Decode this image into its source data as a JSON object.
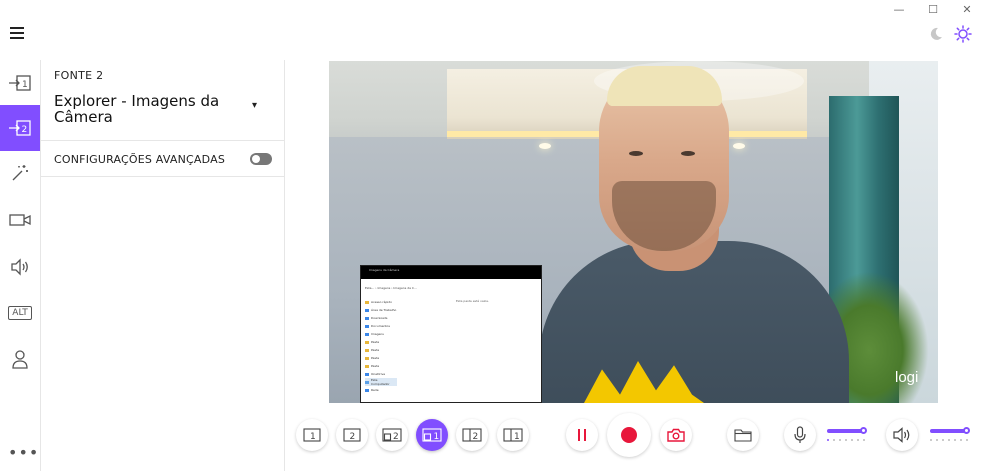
{
  "window": {
    "minimize_glyph": "—",
    "maximize_glyph": "☐",
    "close_glyph": "✕"
  },
  "header": {
    "menu_icon": "hamburger-icon",
    "theme_dark_icon": "moon-icon",
    "theme_light_icon": "sun-icon"
  },
  "rail": {
    "items": [
      {
        "icon": "source-1-icon"
      },
      {
        "icon": "source-2-icon",
        "active": true
      },
      {
        "icon": "magic-wand-icon"
      },
      {
        "icon": "camera-icon"
      },
      {
        "icon": "speaker-icon"
      },
      {
        "icon": "alt-icon",
        "label": "ALT"
      },
      {
        "icon": "user-icon"
      }
    ],
    "more": "•••"
  },
  "panel": {
    "source_heading": "FONTE 2",
    "source_value": "Explorer - Imagens da Câmera",
    "advanced_label": "CONFIGURAÇÕES AVANÇADAS",
    "advanced_enabled": false
  },
  "preview": {
    "watermark": "logi",
    "pip": {
      "title": "Imagens da Câmera",
      "address": "Esta... › Imagens › Imagens da C...",
      "sidebar": [
        "Acesso rápido",
        "Área de Trabalho",
        "Downloads",
        "Documentos",
        "Imagens",
        "Pasta",
        "Pasta",
        "Pasta",
        "Pasta",
        "OneDrive",
        "Este Computador",
        "Rede"
      ],
      "empty_text": "Esta pasta está vazia."
    }
  },
  "controls": {
    "layouts": [
      {
        "icon": "layout-source-1-icon",
        "label": "1"
      },
      {
        "icon": "layout-source-2-icon",
        "label": "2"
      },
      {
        "icon": "layout-pip-1-icon",
        "label": "2"
      },
      {
        "icon": "layout-pip-2-icon",
        "label": "1",
        "active": true
      },
      {
        "icon": "layout-split-1-icon",
        "label": "2"
      },
      {
        "icon": "layout-split-2-icon",
        "label": "1"
      }
    ],
    "pause_icon": "pause-icon",
    "record_icon": "record-icon",
    "snapshot_icon": "camera-snapshot-icon",
    "folder_icon": "folder-icon",
    "mic_icon": "microphone-icon",
    "mic_level": 0.72,
    "speaker_icon": "speaker-volume-icon",
    "speaker_level": 0.9
  },
  "colors": {
    "accent": "#814eff",
    "record": "#e8173b"
  }
}
